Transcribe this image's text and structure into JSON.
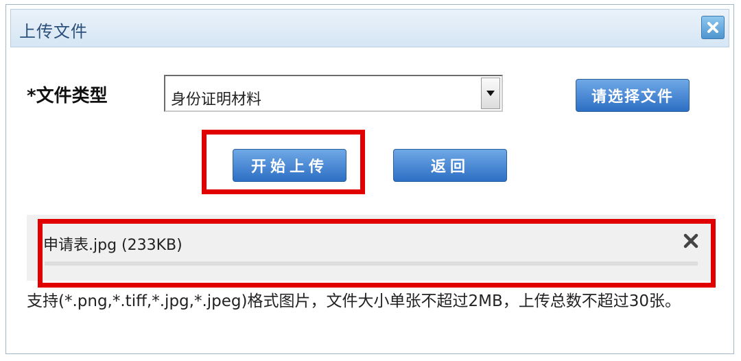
{
  "dialog": {
    "title": "上传文件",
    "close_icon": "close-icon"
  },
  "form": {
    "file_type_label": "*文件类型",
    "file_type_selected": "身份证明材料",
    "choose_file_label": "请选择文件",
    "start_upload_label": "开始上传",
    "back_label": "返回"
  },
  "upload_list": {
    "items": [
      {
        "name": "申请表.jpg (233KB)",
        "remove_icon": "close-icon"
      }
    ]
  },
  "hint": {
    "text": "支持(*.png,*.tiff,*.jpg,*.jpeg)格式图片，文件大小单张不超过2MB，上传总数不超过30张。"
  },
  "colors": {
    "highlight": "#e00000",
    "button": "#2d6fc4",
    "title": "#2a4f7a"
  }
}
